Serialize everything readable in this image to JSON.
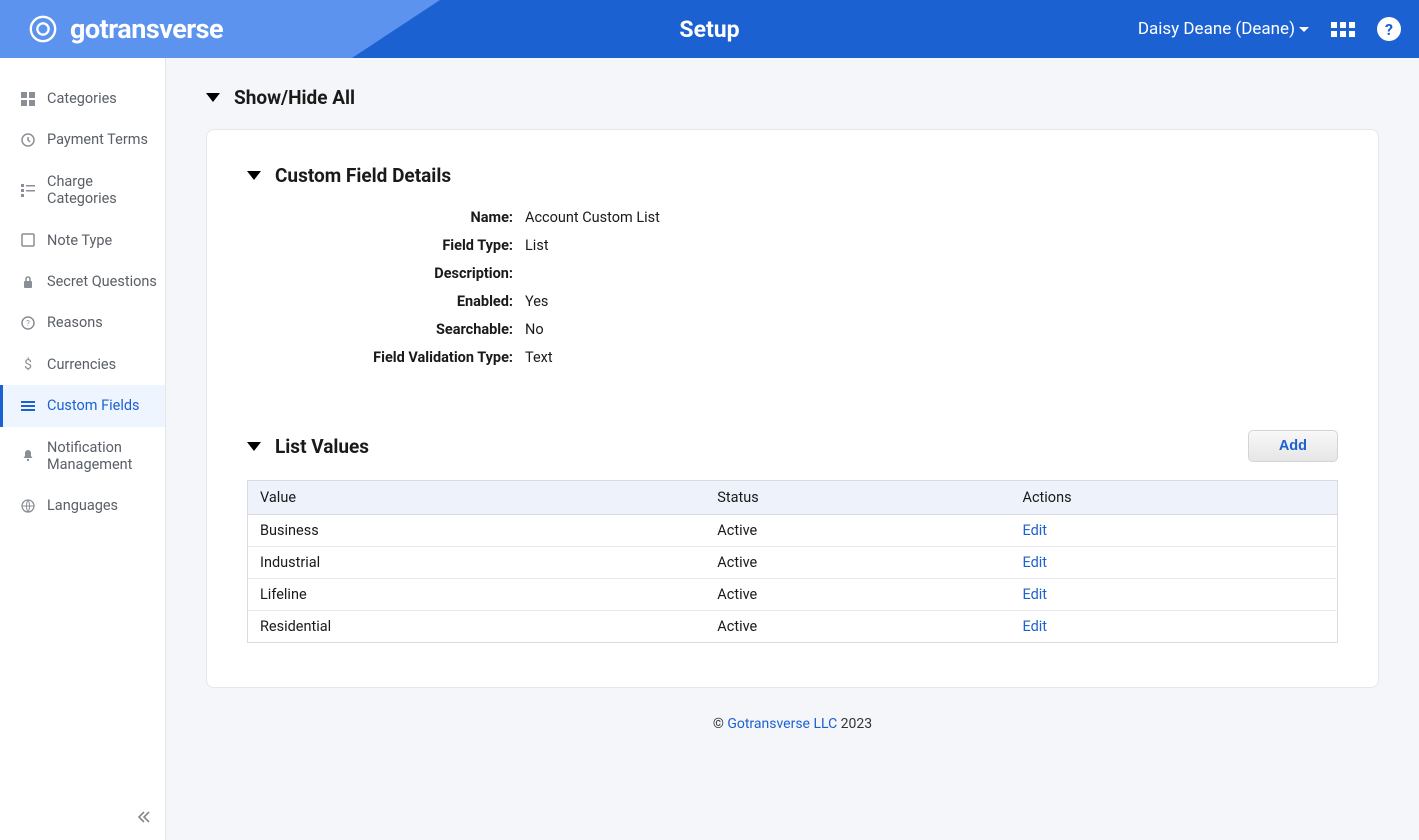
{
  "header": {
    "brand": "gotransverse",
    "title": "Setup",
    "user": "Daisy Deane (Deane)"
  },
  "sidebar": {
    "items": [
      {
        "label": "Categories",
        "icon": "grid"
      },
      {
        "label": "Payment Terms",
        "icon": "clock"
      },
      {
        "label": "Charge Categories",
        "icon": "list-bars"
      },
      {
        "label": "Note Type",
        "icon": "note"
      },
      {
        "label": "Secret Questions",
        "icon": "lock"
      },
      {
        "label": "Reasons",
        "icon": "question"
      },
      {
        "label": "Currencies",
        "icon": "dollar"
      },
      {
        "label": "Custom Fields",
        "icon": "menu",
        "active": true
      },
      {
        "label": "Notification Management",
        "icon": "bell"
      },
      {
        "label": "Languages",
        "icon": "globe"
      }
    ]
  },
  "main": {
    "toggle_all": "Show/Hide All",
    "details": {
      "title": "Custom Field Details",
      "rows": [
        {
          "label": "Name:",
          "value": "Account Custom List"
        },
        {
          "label": "Field Type:",
          "value": "List"
        },
        {
          "label": "Description:",
          "value": ""
        },
        {
          "label": "Enabled:",
          "value": "Yes"
        },
        {
          "label": "Searchable:",
          "value": "No"
        },
        {
          "label": "Field Validation Type:",
          "value": "Text"
        }
      ]
    },
    "list_values": {
      "title": "List Values",
      "add_label": "Add",
      "columns": [
        "Value",
        "Status",
        "Actions"
      ],
      "rows": [
        {
          "value": "Business",
          "status": "Active",
          "action": "Edit"
        },
        {
          "value": "Industrial",
          "status": "Active",
          "action": "Edit"
        },
        {
          "value": "Lifeline",
          "status": "Active",
          "action": "Edit"
        },
        {
          "value": "Residential",
          "status": "Active",
          "action": "Edit"
        }
      ]
    }
  },
  "footer": {
    "copyright": "©",
    "company": "Gotransverse LLC",
    "year": "2023"
  }
}
